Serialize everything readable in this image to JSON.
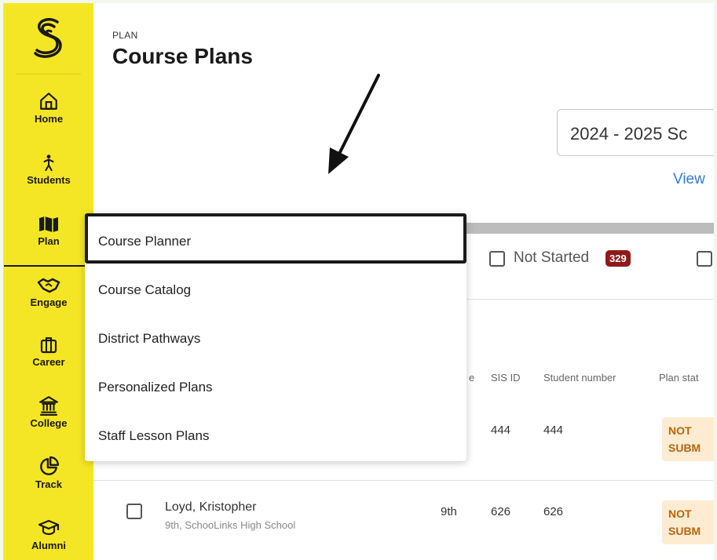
{
  "sidebar": {
    "items": [
      {
        "label": "Home",
        "icon": "home-icon"
      },
      {
        "label": "Students",
        "icon": "person-icon"
      },
      {
        "label": "Plan",
        "icon": "map-icon"
      },
      {
        "label": "Engage",
        "icon": "handshake-icon"
      },
      {
        "label": "Career",
        "icon": "briefcase-icon"
      },
      {
        "label": "College",
        "icon": "building-icon"
      },
      {
        "label": "Track",
        "icon": "pie-chart-icon"
      },
      {
        "label": "Alumni",
        "icon": "graduation-cap-icon"
      }
    ],
    "active": "Plan",
    "accent_color": "#f5e625"
  },
  "header": {
    "eyebrow": "PLAN",
    "title": "Course Plans"
  },
  "year_select": {
    "value": "2024 - 2025 Sc"
  },
  "view_link": "View",
  "filters": {
    "not_started_label": "Not Started",
    "not_started_count": "329"
  },
  "table": {
    "columns": [
      "e",
      "SIS ID",
      "Student number",
      "Plan stat"
    ],
    "rows": [
      {
        "sis_id": "444",
        "student_number": "444",
        "status": "NOT SUBM"
      },
      {
        "name": "Loyd, Kristopher",
        "subtitle": "9th, SchooLinks High School",
        "grade": "9th",
        "sis_id": "626",
        "student_number": "626",
        "status": "NOT SUBM"
      }
    ]
  },
  "plan_menu": {
    "items": [
      "Course Planner",
      "Course Catalog",
      "District Pathways",
      "Personalized Plans",
      "Staff Lesson Plans"
    ],
    "highlighted": "Course Planner"
  },
  "colors": {
    "badge": "#8f1a1a",
    "link": "#2f7bd6",
    "status_bg": "#fdecd2",
    "status_text": "#b8650f"
  }
}
